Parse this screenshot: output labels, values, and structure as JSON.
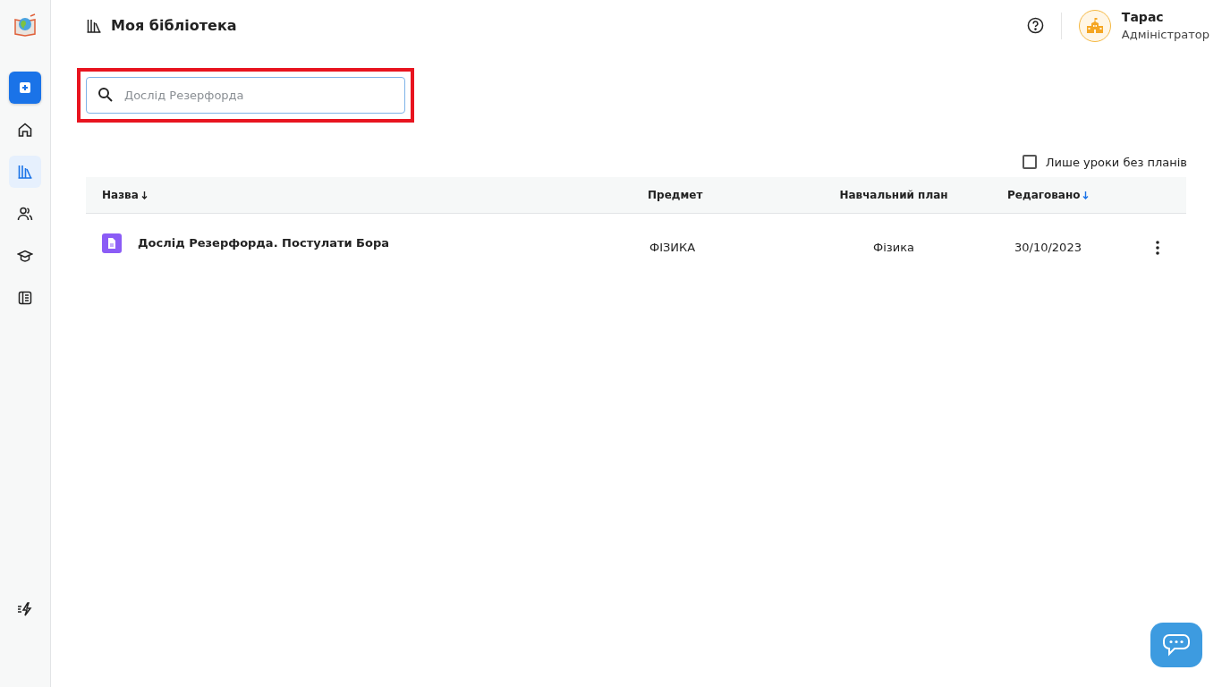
{
  "sidebar": {
    "items": [
      {
        "kind": "add",
        "selected": false
      },
      {
        "kind": "home",
        "selected": false
      },
      {
        "kind": "library",
        "selected": true
      },
      {
        "kind": "users",
        "selected": false
      },
      {
        "kind": "cap",
        "selected": false
      },
      {
        "kind": "book",
        "selected": false
      }
    ]
  },
  "header": {
    "title": "Моя бібліотека",
    "user": {
      "name": "Тарас",
      "role": "Адміністратор"
    }
  },
  "search": {
    "placeholder": "Дослід Резерфорда",
    "highlighted": true
  },
  "filter": {
    "label": "Лише уроки без планів",
    "checked": false
  },
  "table": {
    "columns": [
      {
        "label": "Назва",
        "sortable": true,
        "sorted": false
      },
      {
        "label": "Предмет"
      },
      {
        "label": "Навчальний план"
      },
      {
        "label": "Редаговано",
        "sortable": true,
        "sorted": true
      }
    ],
    "rows": [
      {
        "title": "Дослід Резерфорда. Постулати Бора",
        "subject": "ФІЗИКА",
        "plan": "Фізика",
        "edited": "30/10/2023"
      }
    ]
  }
}
